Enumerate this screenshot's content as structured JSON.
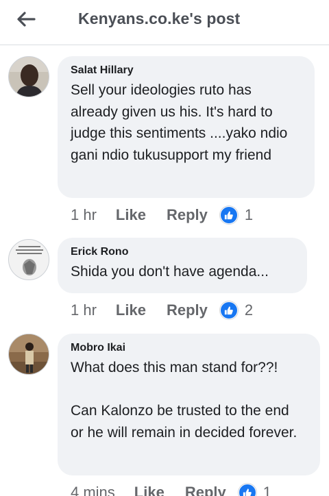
{
  "header": {
    "title": "Kenyans.co.ke's post"
  },
  "comments": [
    {
      "author": "Salat Hillary",
      "text": "Sell your ideologies ruto has already given us his. It's hard to judge this sentiments ....yako ndio gani ndio tukusupport my friend",
      "time": "1 hr",
      "like_label": "Like",
      "reply_label": "Reply",
      "reactions": "1"
    },
    {
      "author": "Erick Rono",
      "text": "Shida you don't have agenda...",
      "time": "1 hr",
      "like_label": "Like",
      "reply_label": "Reply",
      "reactions": "2"
    },
    {
      "author": "Mobro Ikai",
      "text": "What does this man stand for??!\n\nCan Kalonzo be trusted to the end  or he will remain in decided forever.",
      "time": "4 mins",
      "like_label": "Like",
      "reply_label": "Reply",
      "reactions": "1"
    }
  ],
  "colors": {
    "accent": "#1877f2",
    "bubble": "#f0f2f5",
    "muted_text": "#65676b"
  }
}
